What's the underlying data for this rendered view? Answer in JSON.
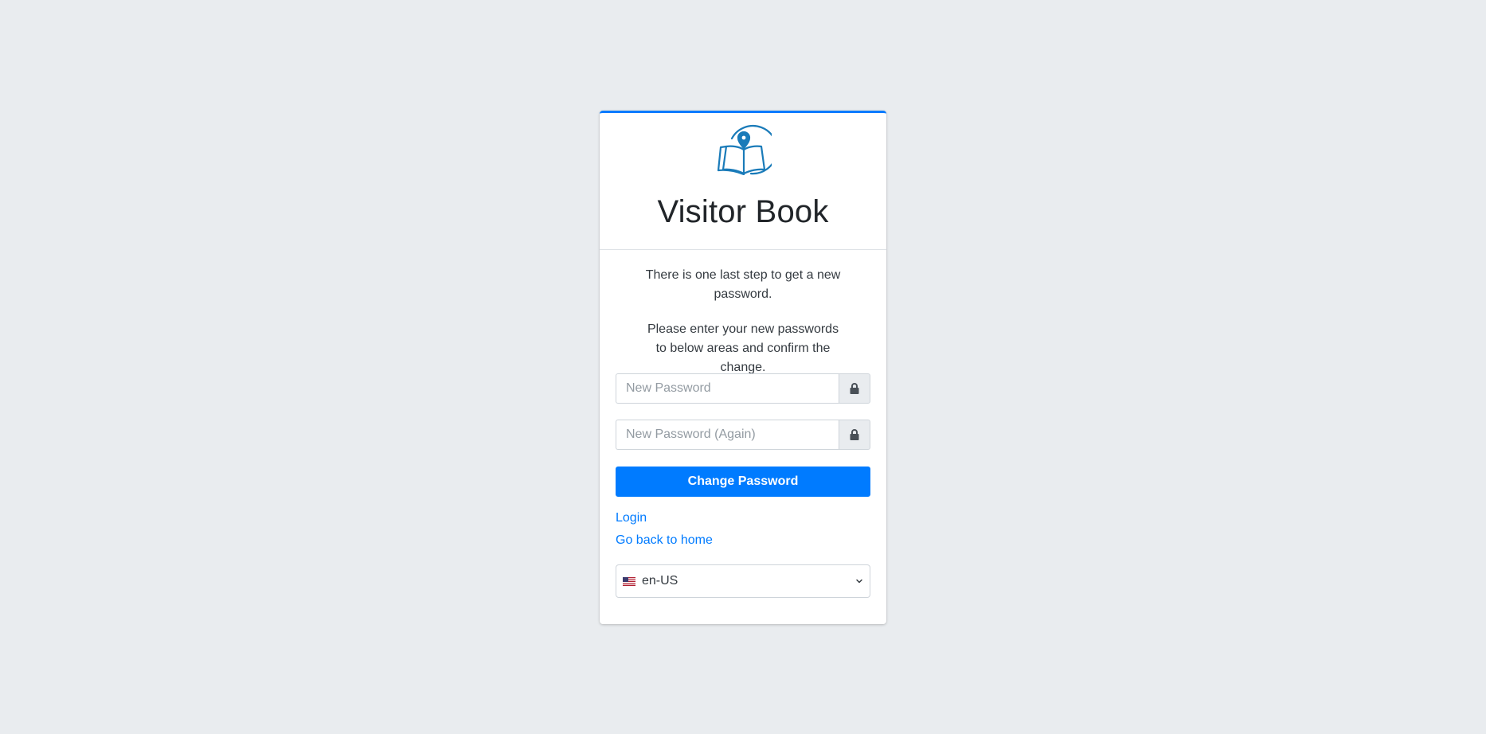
{
  "app": {
    "title": "Visitor Book",
    "logo_icon": "book-map-pin-icon",
    "accent_color": "#007bff",
    "logo_color": "#1a7bb9"
  },
  "message": {
    "line1": "There is one last step to get a new password.",
    "line2": "Please enter your new passwords to below areas and confirm the change."
  },
  "form": {
    "new_password": {
      "placeholder": "New Password",
      "value": "",
      "icon": "lock-icon"
    },
    "new_password_again": {
      "placeholder": "New Password (Again)",
      "value": "",
      "icon": "lock-icon"
    },
    "submit_label": "Change Password"
  },
  "links": {
    "login": "Login",
    "home": "Go back to home"
  },
  "language": {
    "selected": "en-US",
    "flag_icon": "us-flag-icon",
    "dropdown_icon": "chevron-down-icon"
  }
}
